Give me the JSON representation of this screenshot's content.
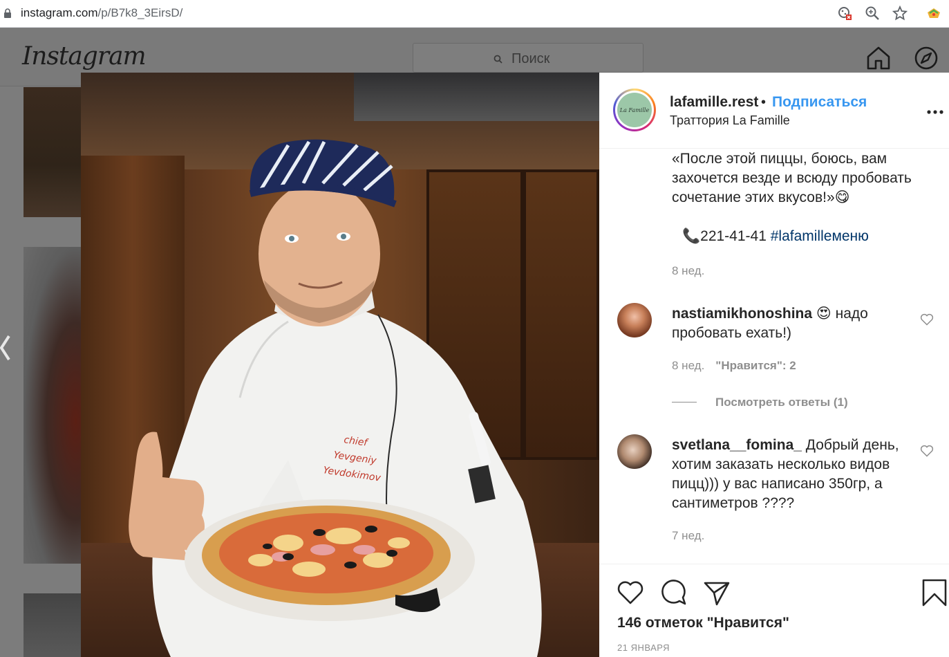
{
  "browser": {
    "url_host": "instagram.com",
    "url_path": "/p/B7k8_3EirsD/"
  },
  "header": {
    "logo": "Instagram",
    "search_placeholder": "Поиск"
  },
  "post": {
    "username": "lafamille.rest",
    "separator": "•",
    "follow_label": "Подписаться",
    "location": "Траттория La Famille",
    "avatar_text": "La Famille",
    "photo_text": [
      "chief",
      "Yevgeniy",
      "Yevdokimov"
    ],
    "caption": "«После этой пиццы, боюсь, вам\nзахочется везде и всюду пробовать\nсочетание этих вкусов!»😋",
    "phone": "📞221-41-41",
    "hashtag": "#lafamilleменю",
    "caption_time": "8 нед.",
    "comments": [
      {
        "username": "nastiamikhonoshina",
        "text": "😍 надо пробовать ехать!)",
        "time": "8 нед.",
        "likes": "\"Нравится\": 2",
        "view_replies": "Посмотреть ответы (1)"
      },
      {
        "username": "svetlana__fomina_",
        "text": "Добрый день, хотим заказать несколько видов пицц))) у вас написано 350гр, а сантиметров ????",
        "time": "7 нед."
      }
    ],
    "likes_count": "146 отметок \"Нравится\"",
    "date": "21 ЯНВАРЯ"
  }
}
